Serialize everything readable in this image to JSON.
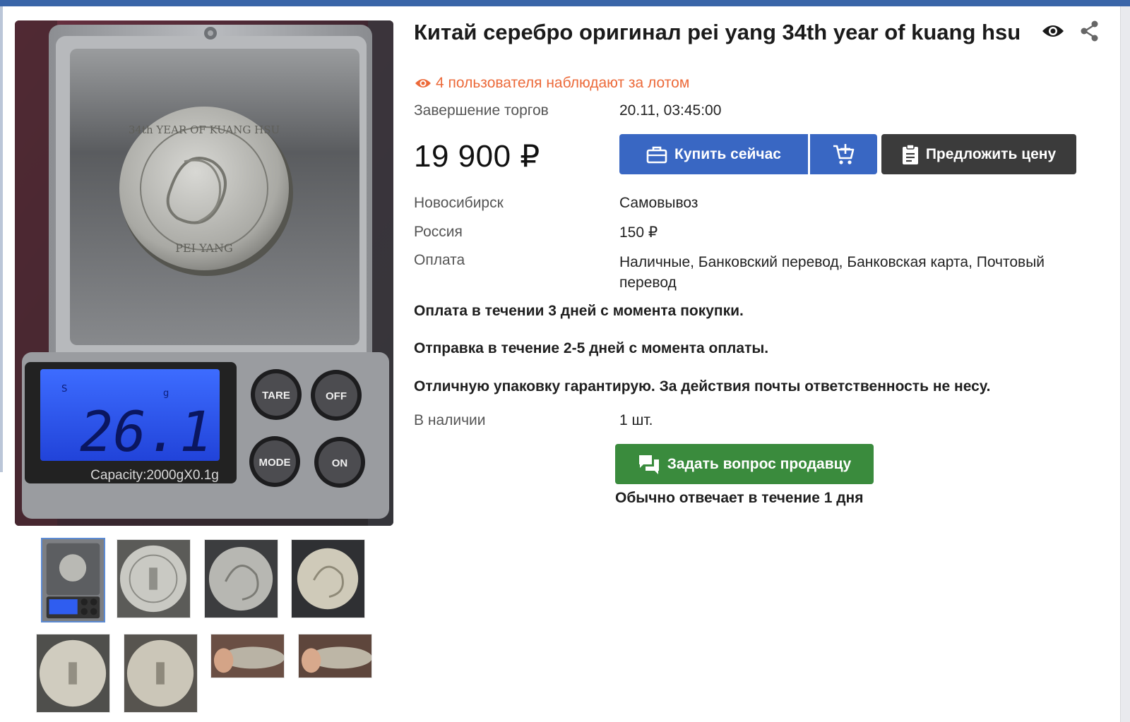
{
  "listing": {
    "title": "Китай серебро оригинал pei yang 34th year of kuang hsu",
    "watchers_text": "4 пользователя наблюдают за лотом",
    "price": "19 900 ₽"
  },
  "details": {
    "end_label": "Завершение торгов",
    "end_value": "20.11, 03:45:00",
    "city_label": "Новосибирск",
    "city_value": "Самовывоз",
    "country_label": "Россия",
    "country_value": "150 ₽",
    "payment_label": "Оплата",
    "payment_value": "Наличные, Банковский перевод, Банковская карта, Почтовый перевод",
    "stock_label": "В наличии",
    "stock_value": "1 шт."
  },
  "buttons": {
    "buy_now": "Купить сейчас",
    "offer_price": "Предложить цену",
    "ask_seller": "Задать вопрос продавцу"
  },
  "notes": {
    "payment_terms": "Оплата в течении 3 дней с момента покупки.",
    "shipping_terms": "Отправка в течение 2-5 дней с момента оплаты.",
    "packaging": "Отличную упаковку гарантирую. За действия почты ответственность не несу.",
    "reply_time": "Обычно отвечает в течение 1 дня"
  },
  "photo": {
    "scale_display": "26.1",
    "scale_unit_g": "g",
    "scale_unit_s": "S",
    "capacity_label": "Capacity:2000gX0.1g",
    "btn_tare": "TARE",
    "btn_off": "OFF",
    "btn_mode": "MODE",
    "btn_on": "ON",
    "coin_text_top": "34th YEAR OF KUANG HSU",
    "coin_text_bottom": "PEI YANG"
  },
  "colors": {
    "accent_blue": "#3967c3",
    "offer_dark": "#3b3b3b",
    "ask_green": "#3a8b3d",
    "watch_orange": "#ec6a3a"
  },
  "icons": {
    "watch": "eye-icon",
    "share": "share-icon",
    "buy": "briefcase-icon",
    "cart": "cart-plus-icon",
    "offer": "clipboard-icon",
    "ask": "chat-bubbles-icon"
  }
}
